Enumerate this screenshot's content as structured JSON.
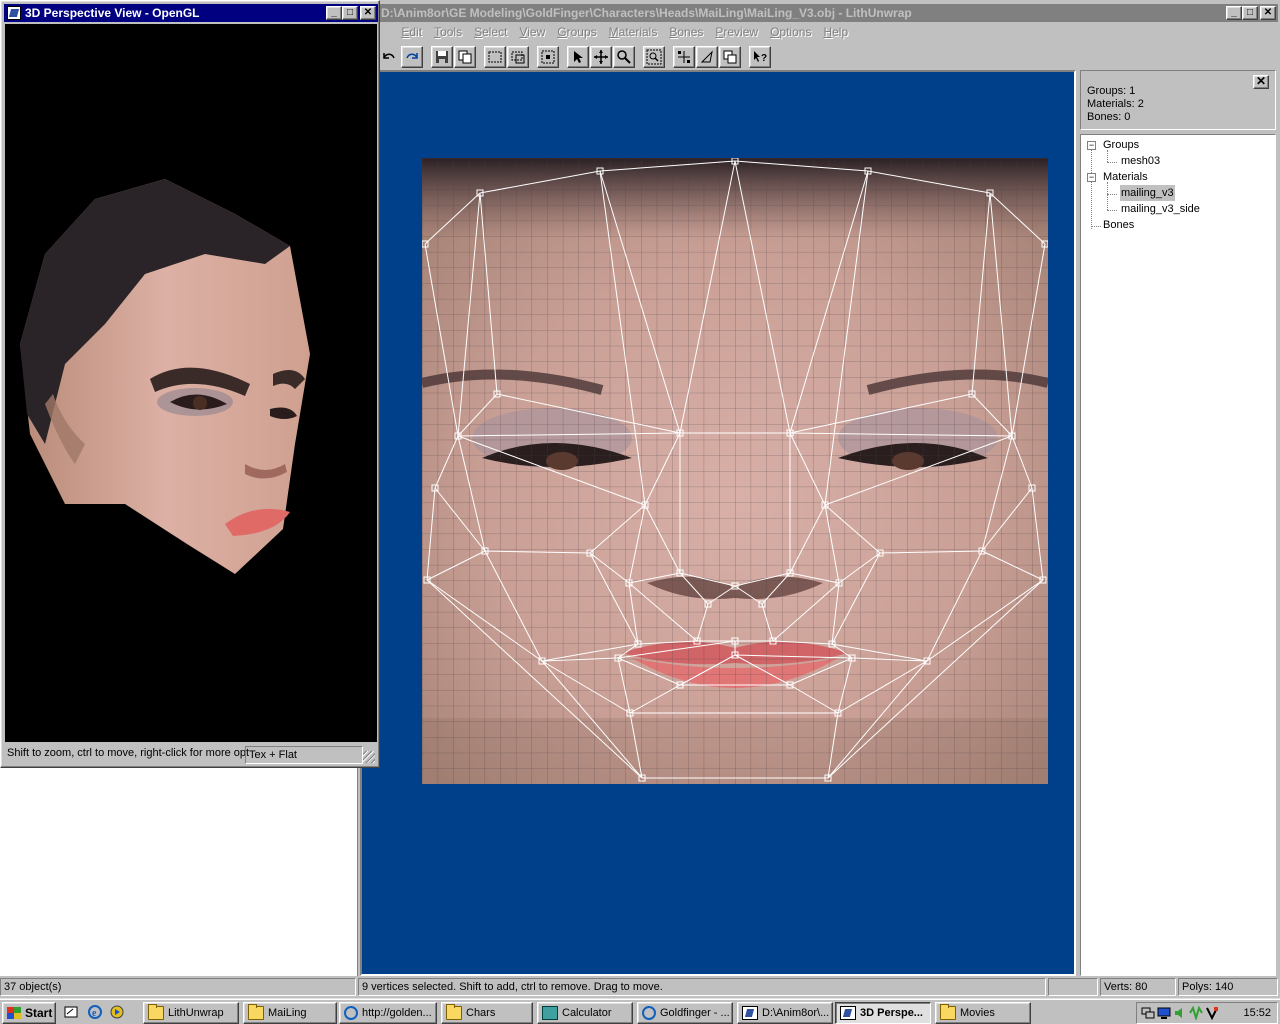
{
  "main_window": {
    "title": "D:\\Anim8or\\GE Modeling\\GoldFinger\\Characters\\Heads\\MaiLing\\MaiLing_V3.obj - LithUnwrap",
    "menu": [
      "File",
      "Edit",
      "Tools",
      "Select",
      "View",
      "Groups",
      "Materials",
      "Bones",
      "Preview",
      "Options",
      "Help"
    ],
    "toolbar_icons": [
      "undo-icon",
      "redo-icon",
      "save-icon",
      "copy-icon",
      "rect-select-icon",
      "rect-deselect-icon",
      "select-all-icon",
      "pointer-icon",
      "move-icon",
      "zoom-icon",
      "zoom-extents-icon",
      "add-vertex-icon",
      "triangle-icon",
      "copy-face-icon",
      "help-icon"
    ]
  },
  "info_panel": {
    "groups": "Groups: 1",
    "materials": "Materials: 2",
    "bones": "Bones: 0"
  },
  "tree": {
    "groups_label": "Groups",
    "group_items": [
      "mesh03"
    ],
    "materials_label": "Materials",
    "material_items": [
      "mailing_v3",
      "mailing_v3_side"
    ],
    "selected_material": "mailing_v3",
    "bones_label": "Bones"
  },
  "status": {
    "objects": "37 object(s)",
    "message": "9 vertices selected.  Shift to add, ctrl to remove.  Drag to move.",
    "verts": "Verts: 80",
    "polys": "Polys: 140"
  },
  "perspective_window": {
    "title": "3D Perspective View - OpenGL",
    "hint": "Shift to zoom, ctrl to move, right-click for more opt",
    "render_mode": "Tex + Flat"
  },
  "taskbar": {
    "start_label": "Start",
    "tasks": [
      {
        "label": "LithUnwrap",
        "icon": "folder-icon",
        "active": false
      },
      {
        "label": "MaiLing",
        "icon": "folder-icon",
        "active": false
      },
      {
        "label": "http://golden...",
        "icon": "ie-icon",
        "active": false
      },
      {
        "label": "Chars",
        "icon": "folder-icon",
        "active": false
      },
      {
        "label": "Calculator",
        "icon": "calculator-icon",
        "active": false
      },
      {
        "label": "Goldfinger - ...",
        "icon": "ie-icon",
        "active": false
      },
      {
        "label": "D:\\Anim8or\\...",
        "icon": "lithunwrap-icon",
        "active": false
      },
      {
        "label": "3D Perspe...",
        "icon": "lithunwrap-icon",
        "active": true
      },
      {
        "label": "Movies",
        "icon": "folder-icon",
        "active": false
      }
    ],
    "clock": "15:52"
  },
  "colors": {
    "viewport_bg": "#003f8a",
    "active_title": "#000080",
    "inactive_title": "#808080",
    "wireframe": "#ffffff"
  }
}
